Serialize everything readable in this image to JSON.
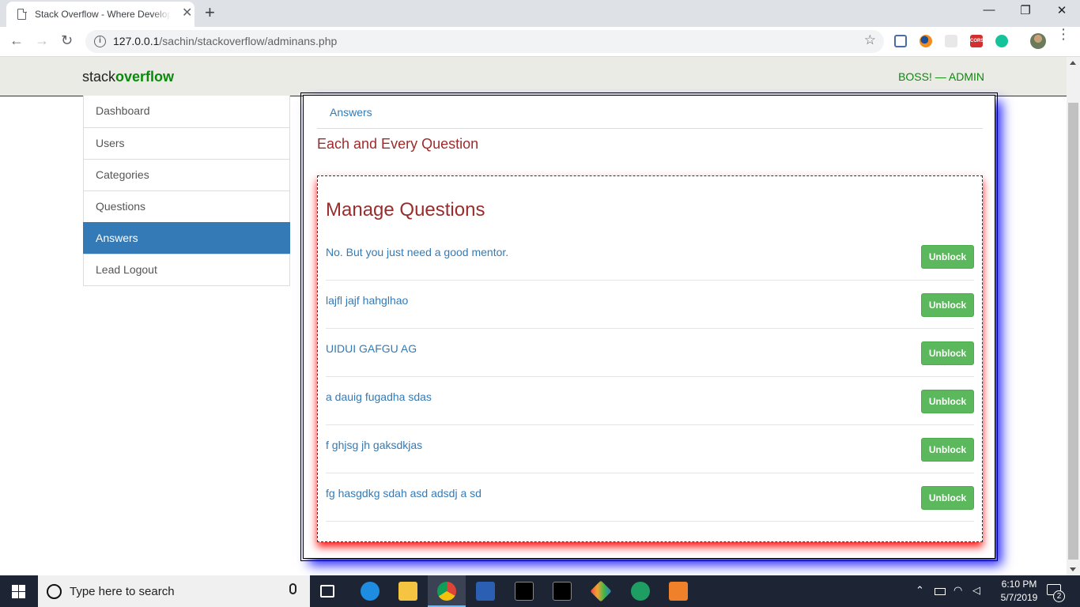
{
  "browser": {
    "tab_title": "Stack Overflow - Where Developers Learn, Share, & Build Careers",
    "tab_close": "✕",
    "new_tab": "+",
    "url_host": "127.0.0.1",
    "url_path": "/sachin/stackoverflow/adminans.php",
    "info_glyph": "i",
    "back": "←",
    "forward": "→",
    "reload": "↻",
    "star": "☆",
    "minimize": "—",
    "restore": "❐",
    "close": "✕",
    "menu": "⋮",
    "extension_badge": "CORS"
  },
  "site": {
    "brand_plain": "stack",
    "brand_bold": "overflow",
    "user": "BOSS! — ADMIN"
  },
  "sidebar": {
    "items": [
      {
        "label": "Dashboard",
        "active": false
      },
      {
        "label": "Users",
        "active": false
      },
      {
        "label": "Categories",
        "active": false
      },
      {
        "label": "Questions",
        "active": false
      },
      {
        "label": "Answers",
        "active": true
      },
      {
        "label": "Lead Logout",
        "active": false
      }
    ]
  },
  "main": {
    "breadcrumb": "Answers",
    "section_title": "Each and Every Question",
    "panel_title": "Manage Questions",
    "button_label": "Unblock",
    "rows": [
      {
        "text": "No. But you just need a good mentor."
      },
      {
        "text": "lajfl jajf hahglhao"
      },
      {
        "text": "UIDUI GAFGU AG"
      },
      {
        "text": "a dauig fugadha sdas"
      },
      {
        "text": "f ghjsg jh gaksdkjas"
      },
      {
        "text": "fg hasgdkg sdah asd adsdj a sd"
      }
    ]
  },
  "taskbar": {
    "search_placeholder": "Type here to search",
    "time": "6:10 PM",
    "date": "5/7/2019",
    "notification_count": "2"
  }
}
